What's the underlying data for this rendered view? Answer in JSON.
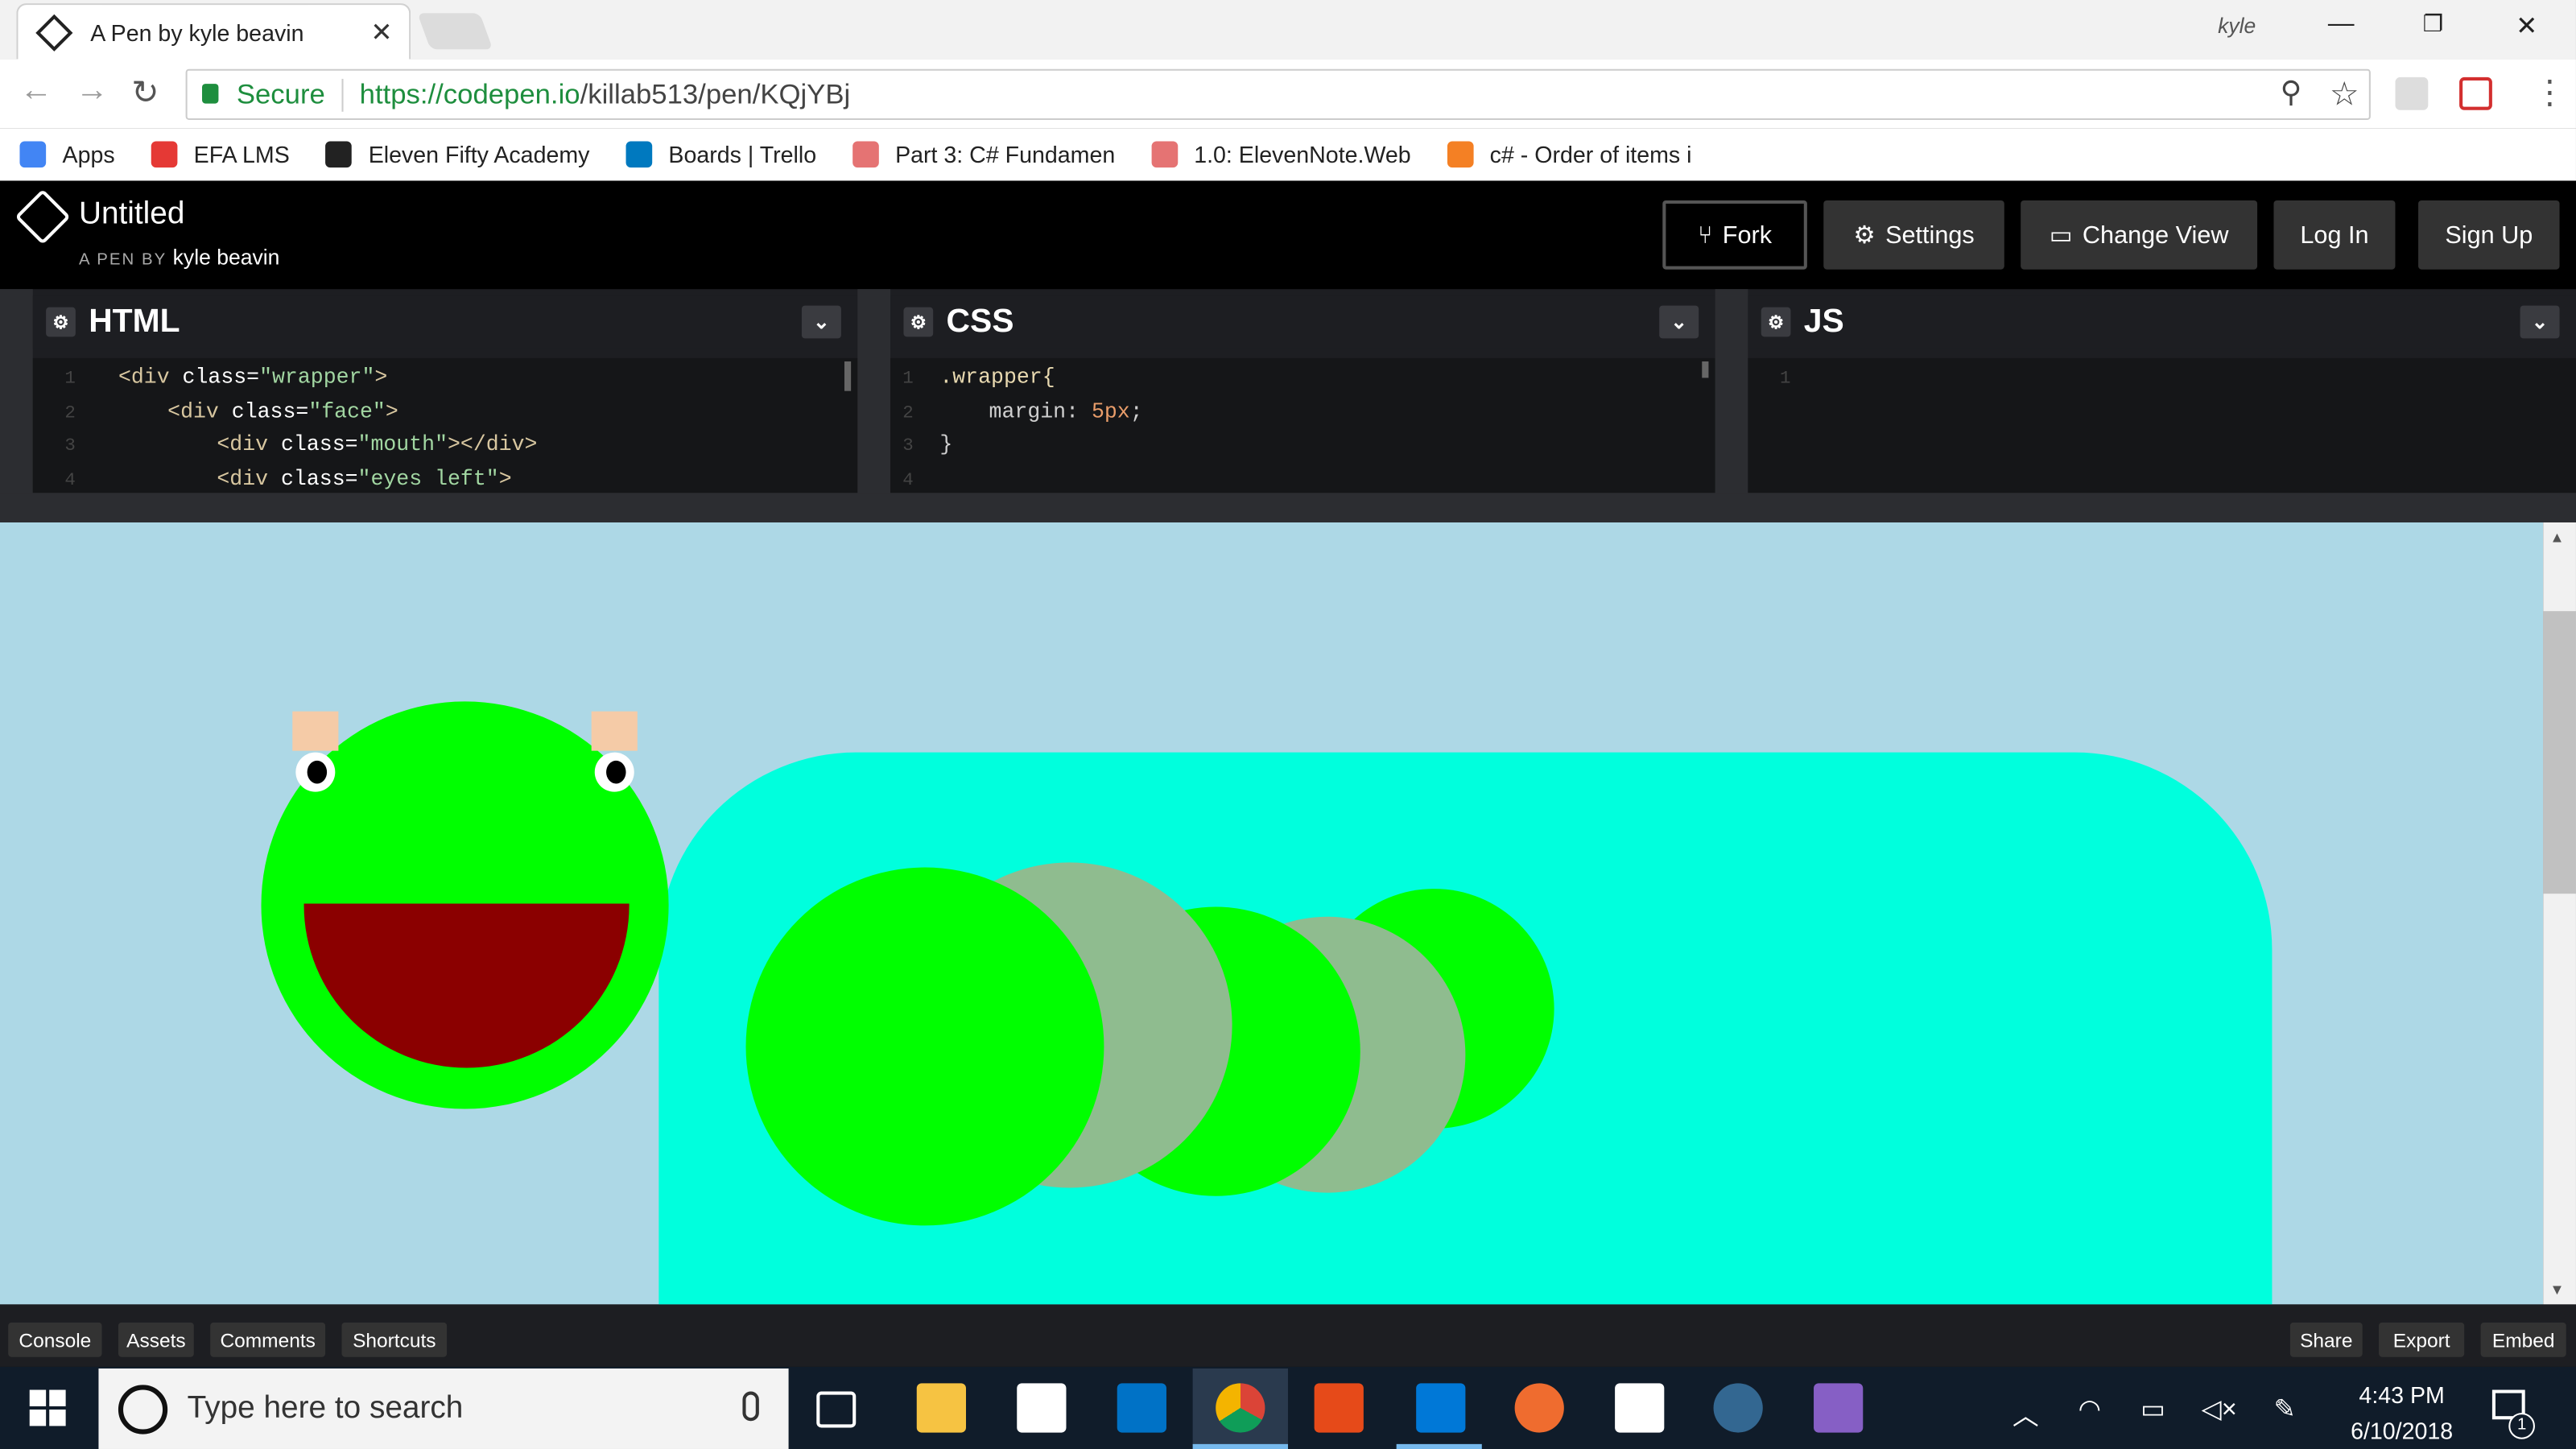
{
  "browser": {
    "tab_title": "A Pen by kyle beavin",
    "tab_close": "✕",
    "profile": "kyle",
    "secure_label": "Secure",
    "url_host": "https://codepen.io",
    "url_path": "/killab513/pen/KQjYBj",
    "bookmarks": [
      {
        "label": "Apps",
        "color": "#4285f4"
      },
      {
        "label": "EFA LMS",
        "color": "#e53935"
      },
      {
        "label": "Eleven Fifty Academy",
        "color": "#222222"
      },
      {
        "label": "Boards | Trello",
        "color": "#0079bf"
      },
      {
        "label": "Part 3: C# Fundamen",
        "color": "#e57373"
      },
      {
        "label": "1.0: ElevenNote.Web",
        "color": "#e57373"
      },
      {
        "label": "c# - Order of items i",
        "color": "#f48024"
      }
    ]
  },
  "codepen": {
    "title": "Untitled",
    "by_prefix": "A PEN BY",
    "author": "kyle beavin",
    "buttons": {
      "fork": "Fork",
      "settings": "Settings",
      "change_view": "Change View",
      "login": "Log In",
      "signup": "Sign Up"
    },
    "panes": {
      "html": "HTML",
      "css": "CSS",
      "js": "JS"
    },
    "footer": {
      "console": "Console",
      "assets": "Assets",
      "comments": "Comments",
      "shortcuts": "Shortcuts",
      "share": "Share",
      "export": "Export",
      "embed": "Embed"
    },
    "html_code": {
      "l1": {
        "n": "1",
        "open": "<div ",
        "attr": "class=",
        "val": "\"wrapper\"",
        "close": ">"
      },
      "l2": {
        "n": "2",
        "open": "<div ",
        "attr": "class=",
        "val": "\"face\"",
        "close": ">"
      },
      "l3": {
        "n": "3",
        "open": "<div ",
        "attr": "class=",
        "val": "\"mouth\"",
        "close": "></div>"
      },
      "l4": {
        "n": "4",
        "open": "<div ",
        "attr": "class=",
        "val": "\"eyes left\"",
        "close": ">"
      }
    },
    "css_code": {
      "l1": {
        "n": "1",
        "sel": ".wrapper{"
      },
      "l2": {
        "n": "2",
        "prop": "margin: ",
        "val": "5px",
        "end": ";"
      },
      "l3": {
        "n": "3",
        "text": "}"
      },
      "l4": {
        "n": "4"
      }
    },
    "js_code": {
      "l1": {
        "n": "1"
      }
    }
  },
  "taskbar": {
    "search_placeholder": "Type here to search",
    "time": "4:43 PM",
    "date": "6/10/2018",
    "notifications": "1"
  },
  "colors": {
    "preview_bg": "#add8e6",
    "body_bg": "#00ffdd",
    "green": "#00ff00",
    "sage": "#8fbc8f",
    "mouth": "#8b0000",
    "ears": "#f5cba7"
  }
}
